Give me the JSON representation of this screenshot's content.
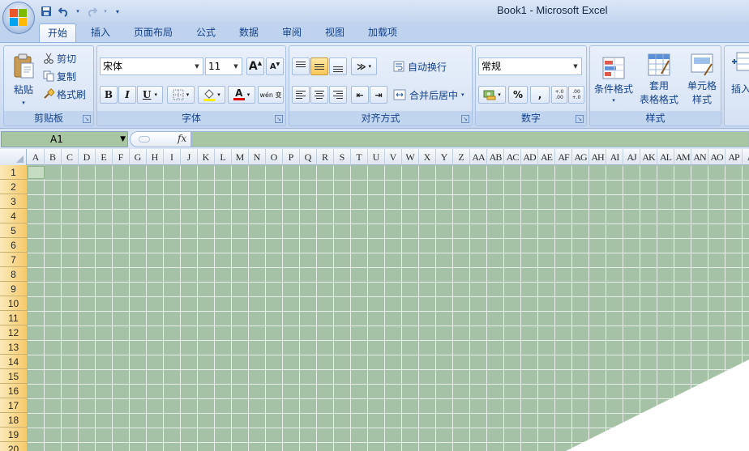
{
  "window": {
    "title": "Book1 - Microsoft Excel"
  },
  "tabs": [
    "开始",
    "插入",
    "页面布局",
    "公式",
    "数据",
    "审阅",
    "视图",
    "加载项"
  ],
  "clipboard": {
    "paste": "粘贴",
    "cut": "剪切",
    "copy": "复制",
    "format_painter": "格式刷",
    "label": "剪贴板"
  },
  "font": {
    "name": "宋体",
    "size": "11",
    "label": "字体",
    "bold": "B",
    "italic": "I",
    "underline": "U",
    "grow": "A",
    "shrink": "A",
    "color_glyph": "A",
    "phonetic": "wén 变"
  },
  "alignment": {
    "wrap": "自动换行",
    "merge": "合并后居中",
    "label": "对齐方式"
  },
  "number": {
    "format": "常规",
    "percent": "%",
    "comma": ",",
    "label": "数字",
    "inc_decimal": "+.0 .00",
    "dec_decimal": ".00 +.0"
  },
  "styles": {
    "conditional": "条件格式",
    "table_line1": "套用",
    "table_line2": "表格格式",
    "cell_line1": "单元格",
    "cell_line2": "样式",
    "label": "样式"
  },
  "cells": {
    "insert": "插入"
  },
  "formula_bar": {
    "name_box": "A1",
    "fx": "fx"
  },
  "columns": [
    "A",
    "B",
    "C",
    "D",
    "E",
    "F",
    "G",
    "H",
    "I",
    "J",
    "K",
    "L",
    "M",
    "N",
    "O",
    "P",
    "Q",
    "R",
    "S",
    "T",
    "U",
    "V",
    "W",
    "X",
    "Y",
    "Z",
    "AA",
    "AB",
    "AC",
    "AD",
    "AE",
    "AF",
    "AG",
    "AH",
    "AI",
    "AJ",
    "AK",
    "AL",
    "AM",
    "AN",
    "AO",
    "AP",
    "A"
  ],
  "rows": [
    "1",
    "2",
    "3",
    "4",
    "5",
    "6",
    "7",
    "8",
    "9",
    "10",
    "11",
    "12",
    "13",
    "14",
    "15",
    "16",
    "17",
    "18",
    "19",
    "20"
  ],
  "colors": {
    "grid_bg": "#a6c2a6",
    "row_header": "#f5c96a",
    "ribbon": "#d1def1"
  }
}
